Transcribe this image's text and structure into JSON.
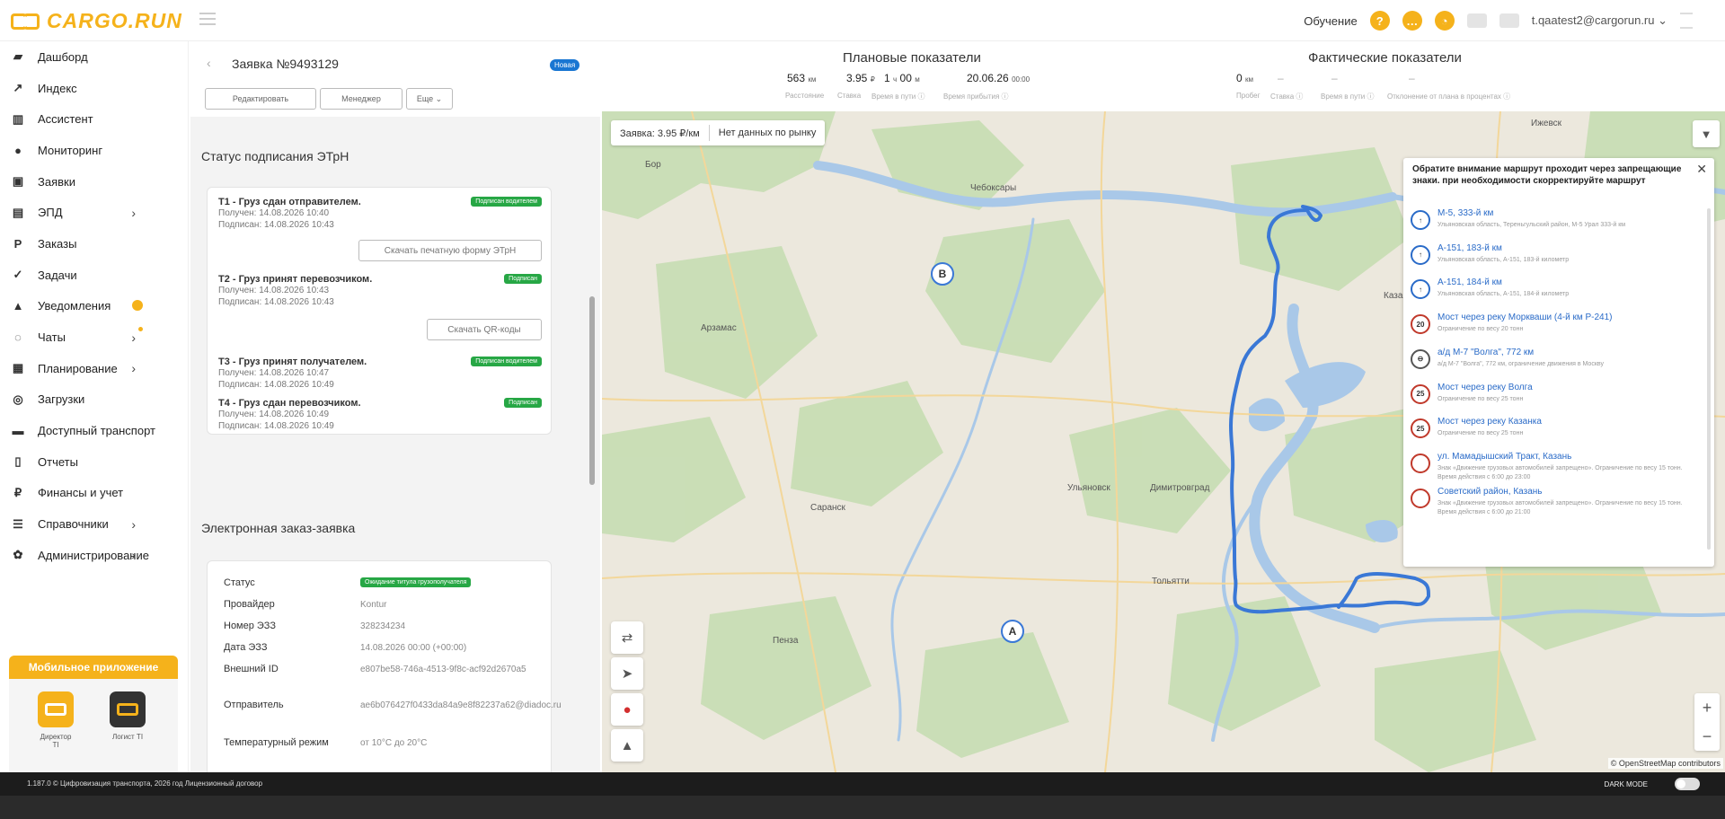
{
  "header": {
    "logo_text": "CARGO.RUN",
    "learning_label": "Обучение",
    "user_email": "t.qaatest2@cargorun.ru ⌄"
  },
  "sidebar": {
    "items": [
      {
        "label": "Дашборд",
        "icon": "dashboard-icon",
        "glyph": "▰"
      },
      {
        "label": "Индекс",
        "icon": "index-icon",
        "glyph": "↗"
      },
      {
        "label": "Ассистент",
        "icon": "assistant-icon",
        "glyph": "▥"
      },
      {
        "label": "Мониторинг",
        "icon": "location-pin-icon",
        "glyph": "●"
      },
      {
        "label": "Заявки",
        "icon": "requests-icon",
        "glyph": "▣"
      },
      {
        "label": "ЭПД",
        "icon": "epd-icon",
        "glyph": "▤"
      },
      {
        "label": "Заказы",
        "icon": "orders-icon",
        "glyph": "P"
      },
      {
        "label": "Задачи",
        "icon": "check-icon",
        "glyph": "✓"
      },
      {
        "label": "Уведомления",
        "icon": "bell-icon",
        "glyph": "▲"
      },
      {
        "label": "Чаты",
        "icon": "chat-icon",
        "glyph": "◌"
      },
      {
        "label": "Планирование",
        "icon": "planning-icon",
        "glyph": "▦"
      },
      {
        "label": "Загрузки",
        "icon": "loads-icon",
        "glyph": "◎"
      },
      {
        "label": "Доступный транспорт",
        "icon": "truck-icon",
        "glyph": "▬"
      },
      {
        "label": "Отчеты",
        "icon": "reports-icon",
        "glyph": "▯"
      },
      {
        "label": "Финансы и учет",
        "icon": "finance-icon",
        "glyph": "₽"
      },
      {
        "label": "Справочники",
        "icon": "list-icon",
        "glyph": "☰"
      },
      {
        "label": "Администрирование",
        "icon": "gear-icon",
        "glyph": "✿"
      }
    ],
    "mobile_title": "Мобильное приложение",
    "app1": "Директор TI",
    "app2": "Логист TI"
  },
  "order": {
    "title": "Заявка №9493129",
    "badge": "Новая",
    "btn_edit": "Редактировать",
    "btn_manager": "Менеджер",
    "btn_more": "Еще ⌄"
  },
  "etrn": {
    "section_title": "Статус подписания ЭТрН",
    "steps": [
      {
        "title": "Т1 - Груз сдан отправителем.",
        "received": "Получен: 14.08.2026 10:40",
        "signed": "Подписан: 14.08.2026 10:43",
        "status": "Подписан водителем"
      },
      {
        "title": "Т2 - Груз принят перевозчиком.",
        "received": "Получен: 14.08.2026 10:43",
        "signed": "Подписан: 14.08.2026 10:43",
        "status": "Подписан"
      },
      {
        "title": "Т3 - Груз принят получателем.",
        "received": "Получен: 14.08.2026 10:47",
        "signed": "Подписан: 14.08.2026 10:49",
        "status": "Подписан водителем"
      },
      {
        "title": "Т4 - Груз сдан перевозчиком.",
        "received": "Получен: 14.08.2026 10:49",
        "signed": "Подписан: 14.08.2026 10:49",
        "status": "Подписан"
      }
    ],
    "btn_print": "Скачать печатную форму ЭТрН",
    "btn_qr": "Скачать QR-коды"
  },
  "ezz": {
    "section_title": "Электронная заказ-заявка",
    "rows": [
      {
        "k": "Статус",
        "v": "Ожидание титула грузополучателя"
      },
      {
        "k": "Провайдер",
        "v": "Kontur"
      },
      {
        "k": "Номер ЭЗЗ",
        "v": "328234234"
      },
      {
        "k": "Дата ЭЗЗ",
        "v": "14.08.2026 00:00 (+00:00)"
      },
      {
        "k": "Внешний ID",
        "v": "e807be58-746a-4513-9f8c-acf92d2670a5"
      },
      {
        "k": "Отправитель",
        "v": "ae6b076427f0433da84a9e8f82237a62@diadoc.ru"
      },
      {
        "k": "Температурный режим",
        "v": "от 10°С до 20°С"
      }
    ]
  },
  "stats": {
    "plan_title": "Плановые показатели",
    "fact_title": "Фактические показатели",
    "plan_distance": "563",
    "plan_distance_unit": "км",
    "plan_rate": "3.95",
    "plan_rate_unit": "₽",
    "plan_time": "1",
    "plan_time_h": "ч",
    "plan_time_m": "00",
    "plan_time_munit": "м",
    "plan_date": "20.06.26",
    "plan_date_time": "00:00",
    "plan_labels": [
      "Расстояние",
      "Ставка",
      "Время в пути ⓘ",
      "Время прибытия ⓘ"
    ],
    "fact_distance": "0",
    "fact_distance_unit": "км",
    "fact_dash": "–",
    "fact_labels": [
      "Пробег",
      "Ставка ⓘ",
      "Время в пути ⓘ",
      "Отклонение от плана в процентах ⓘ"
    ]
  },
  "map": {
    "chip_rate": "Заявка: 3.95 ₽/км",
    "chip_market": "Нет данных по рынку",
    "cities": [
      "Ижевск",
      "Чебоксары",
      "Арзамас",
      "Саранск",
      "Ульяновск",
      "Димитровград",
      "Тольятти",
      "Казань",
      "Пенза"
    ],
    "pin_a": "A",
    "pin_b": "B",
    "zoom_in": "+",
    "zoom_out": "−",
    "attribution": "© OpenStreetMap contributors",
    "filter_glyph": "▼",
    "warnings_title": "Обратите внимание маршрут проходит через запрещающие знаки. при необходимости скорректируйте маршрут",
    "warnings": [
      {
        "title": "М-5, 333-й км",
        "desc": "Ульяновская область, Тереньгульский район, М-5 Урал 333-й км",
        "mark": "↑",
        "color": "#2a6bc8"
      },
      {
        "title": "А-151, 183-й км",
        "desc": "Ульяновская область, А-151, 183-й километр",
        "mark": "↑",
        "color": "#2a6bc8"
      },
      {
        "title": "А-151, 184-й км",
        "desc": "Ульяновская область, А-151, 184-й километр",
        "mark": "↑",
        "color": "#2a6bc8"
      },
      {
        "title": "Мост через реку Моркваши (4-й км Р-241)",
        "desc": "Ограничение по весу 20 тонн",
        "mark": "20",
        "color": "#c0392b"
      },
      {
        "title": "а/д М-7 \"Волга\", 772 км",
        "desc": "а/д М-7 \"Волга\", 772 км, ограничение движения в Москву",
        "mark": "⊖",
        "color": "#555"
      },
      {
        "title": "Мост через реку Волга",
        "desc": "Ограничение по весу 25 тонн",
        "mark": "25",
        "color": "#c0392b"
      },
      {
        "title": "Мост через реку Казанка",
        "desc": "Ограничение по весу 25 тонн",
        "mark": "25",
        "color": "#c0392b"
      },
      {
        "title": "ул. Мамадышский Тракт, Казань",
        "desc": "Знак «Движение грузовых автомобилей запрещено». Ограничение по весу 15 тонн. Время действия с 6:00 до 23:00",
        "mark": "",
        "color": "#c0392b"
      },
      {
        "title": "Советский район, Казань",
        "desc": "Знак «Движение грузовых автомобилей запрещено». Ограничение по весу 15 тонн. Время действия с 6:00 до 21:00",
        "mark": "",
        "color": "#c0392b"
      }
    ]
  },
  "footer": {
    "text": "1.187.0 © Цифровизация транспорта, 2026 год   Лицензионный договор",
    "dark_mode": "DARK MODE"
  }
}
